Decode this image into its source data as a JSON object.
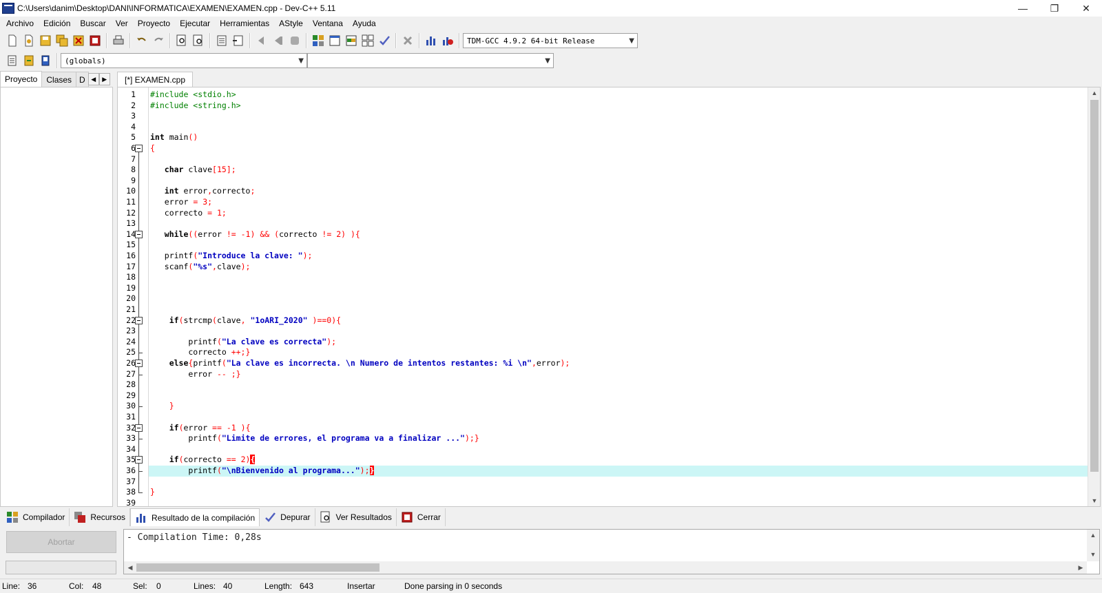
{
  "window": {
    "title": "C:\\Users\\danim\\Desktop\\DANI\\INFORMATICA\\EXAMEN\\EXAMEN.cpp - Dev-C++ 5.11",
    "minimize": "—",
    "restore": "❐",
    "close": "✕"
  },
  "menu": [
    "Archivo",
    "Edición",
    "Buscar",
    "Ver",
    "Proyecto",
    "Ejecutar",
    "Herramientas",
    "AStyle",
    "Ventana",
    "Ayuda"
  ],
  "toolbar": {
    "compiler_select": "TDM-GCC 4.9.2 64-bit Release",
    "scope_select": "(globals)",
    "member_select": ""
  },
  "left_tabs": [
    "Proyecto",
    "Clases",
    "D"
  ],
  "editor_tab": "[*] EXAMEN.cpp",
  "code": {
    "lines": [
      [
        {
          "t": "#include <stdio.h>",
          "c": "pp"
        }
      ],
      [
        {
          "t": "#include <string.h>",
          "c": "pp"
        }
      ],
      [],
      [],
      [
        {
          "t": "int",
          "c": "kw"
        },
        {
          "t": " main"
        },
        {
          "t": "()",
          "c": "sym"
        }
      ],
      [
        {
          "t": "{",
          "c": "sym"
        }
      ],
      [],
      [
        {
          "t": "   "
        },
        {
          "t": "char",
          "c": "kw"
        },
        {
          "t": " clave"
        },
        {
          "t": "[",
          "c": "sym"
        },
        {
          "t": "15",
          "c": "num"
        },
        {
          "t": "];",
          "c": "sym"
        }
      ],
      [],
      [
        {
          "t": "   "
        },
        {
          "t": "int",
          "c": "kw"
        },
        {
          "t": " error"
        },
        {
          "t": ",",
          "c": "sym"
        },
        {
          "t": "correcto"
        },
        {
          "t": ";",
          "c": "sym"
        }
      ],
      [
        {
          "t": "   error "
        },
        {
          "t": "=",
          "c": "sym"
        },
        {
          "t": " "
        },
        {
          "t": "3",
          "c": "num"
        },
        {
          "t": ";",
          "c": "sym"
        }
      ],
      [
        {
          "t": "   correcto "
        },
        {
          "t": "=",
          "c": "sym"
        },
        {
          "t": " "
        },
        {
          "t": "1",
          "c": "num"
        },
        {
          "t": ";",
          "c": "sym"
        }
      ],
      [],
      [
        {
          "t": "   "
        },
        {
          "t": "while",
          "c": "kw"
        },
        {
          "t": "((",
          "c": "sym"
        },
        {
          "t": "error "
        },
        {
          "t": "!=",
          "c": "sym"
        },
        {
          "t": " "
        },
        {
          "t": "-1",
          "c": "num"
        },
        {
          "t": ")",
          "c": "sym"
        },
        {
          "t": " "
        },
        {
          "t": "&&",
          "c": "sym"
        },
        {
          "t": " "
        },
        {
          "t": "(",
          "c": "sym"
        },
        {
          "t": "correcto "
        },
        {
          "t": "!=",
          "c": "sym"
        },
        {
          "t": " "
        },
        {
          "t": "2",
          "c": "num"
        },
        {
          "t": ")",
          "c": "sym"
        },
        {
          "t": " "
        },
        {
          "t": "){",
          "c": "sym"
        }
      ],
      [],
      [
        {
          "t": "   printf"
        },
        {
          "t": "(",
          "c": "sym"
        },
        {
          "t": "\"Introduce la clave: \"",
          "c": "str"
        },
        {
          "t": ");",
          "c": "sym"
        }
      ],
      [
        {
          "t": "   scanf"
        },
        {
          "t": "(",
          "c": "sym"
        },
        {
          "t": "\"%s\"",
          "c": "str"
        },
        {
          "t": ",",
          "c": "sym"
        },
        {
          "t": "clave"
        },
        {
          "t": ");",
          "c": "sym"
        }
      ],
      [],
      [],
      [],
      [],
      [
        {
          "t": "    "
        },
        {
          "t": "if",
          "c": "kw"
        },
        {
          "t": "(",
          "c": "sym"
        },
        {
          "t": "strcmp"
        },
        {
          "t": "(",
          "c": "sym"
        },
        {
          "t": "clave"
        },
        {
          "t": ",",
          "c": "sym"
        },
        {
          "t": " "
        },
        {
          "t": "\"1oARI_2020\"",
          "c": "str"
        },
        {
          "t": " "
        },
        {
          "t": ")==",
          "c": "sym"
        },
        {
          "t": "0",
          "c": "num"
        },
        {
          "t": "){",
          "c": "sym"
        }
      ],
      [],
      [
        {
          "t": "        printf"
        },
        {
          "t": "(",
          "c": "sym"
        },
        {
          "t": "\"La clave es correcta\"",
          "c": "str"
        },
        {
          "t": ");",
          "c": "sym"
        }
      ],
      [
        {
          "t": "        correcto "
        },
        {
          "t": "++;}",
          "c": "sym"
        }
      ],
      [
        {
          "t": "    "
        },
        {
          "t": "else",
          "c": "kw"
        },
        {
          "t": "{",
          "c": "sym"
        },
        {
          "t": "printf"
        },
        {
          "t": "(",
          "c": "sym"
        },
        {
          "t": "\"La clave es incorrecta. \\n Numero de intentos restantes: %i \\n\"",
          "c": "str"
        },
        {
          "t": ",",
          "c": "sym"
        },
        {
          "t": "error"
        },
        {
          "t": ");",
          "c": "sym"
        }
      ],
      [
        {
          "t": "        error "
        },
        {
          "t": "--",
          "c": "sym"
        },
        {
          "t": " "
        },
        {
          "t": ";}",
          "c": "sym"
        }
      ],
      [],
      [],
      [
        {
          "t": "    "
        },
        {
          "t": "}",
          "c": "sym"
        }
      ],
      [],
      [
        {
          "t": "    "
        },
        {
          "t": "if",
          "c": "kw"
        },
        {
          "t": "(",
          "c": "sym"
        },
        {
          "t": "error "
        },
        {
          "t": "==",
          "c": "sym"
        },
        {
          "t": " "
        },
        {
          "t": "-1",
          "c": "num"
        },
        {
          "t": " "
        },
        {
          "t": "){",
          "c": "sym"
        }
      ],
      [
        {
          "t": "        printf"
        },
        {
          "t": "(",
          "c": "sym"
        },
        {
          "t": "\"Limite de errores, el programa va a finalizar ...\"",
          "c": "str"
        },
        {
          "t": ");}",
          "c": "sym"
        }
      ],
      [],
      [
        {
          "t": "    "
        },
        {
          "t": "if",
          "c": "kw"
        },
        {
          "t": "(",
          "c": "sym"
        },
        {
          "t": "correcto "
        },
        {
          "t": "==",
          "c": "sym"
        },
        {
          "t": " "
        },
        {
          "t": "2",
          "c": "num"
        },
        {
          "t": ")",
          "c": "sym"
        },
        {
          "t": "{",
          "c": "caret-br"
        }
      ],
      [
        {
          "t": "        printf"
        },
        {
          "t": "(",
          "c": "sym"
        },
        {
          "t": "\"\\nBienvenido al programa...\"",
          "c": "str"
        },
        {
          "t": ");",
          "c": "sym"
        },
        {
          "t": "}",
          "c": "caret-br"
        }
      ],
      [],
      [
        {
          "t": "}",
          "c": "sym"
        }
      ],
      []
    ],
    "line_numbers": [
      "1",
      "2",
      "3",
      "4",
      "5",
      "6",
      "7",
      "8",
      "9",
      "10",
      "11",
      "12",
      "13",
      "14",
      "15",
      "16",
      "17",
      "18",
      "19",
      "20",
      "21",
      "22",
      "23",
      "24",
      "25",
      "26",
      "27",
      "28",
      "29",
      "30",
      "31",
      "32",
      "33",
      "34",
      "35",
      "36",
      "37",
      "38",
      "39"
    ],
    "current_line": 36
  },
  "bottom_tabs": [
    {
      "label": "Compilador",
      "icon": "compiler-grid-icon"
    },
    {
      "label": "Recursos",
      "icon": "resources-icon"
    },
    {
      "label": "Resultado de la compilación",
      "icon": "chart-icon"
    },
    {
      "label": "Depurar",
      "icon": "check-icon"
    },
    {
      "label": "Ver Resultados",
      "icon": "view-results-icon"
    },
    {
      "label": "Cerrar",
      "icon": "close-bug-icon"
    }
  ],
  "bottom": {
    "abort_label": "Abortar",
    "output": "- Compilation Time: 0,28s"
  },
  "status": {
    "line_label": "Line:",
    "line_value": "36",
    "col_label": "Col:",
    "col_value": "48",
    "sel_label": "Sel:",
    "sel_value": "0",
    "lines_label": "Lines:",
    "lines_value": "40",
    "length_label": "Length:",
    "length_value": "643",
    "mode": "Insertar",
    "message": "Done parsing in 0 seconds"
  }
}
